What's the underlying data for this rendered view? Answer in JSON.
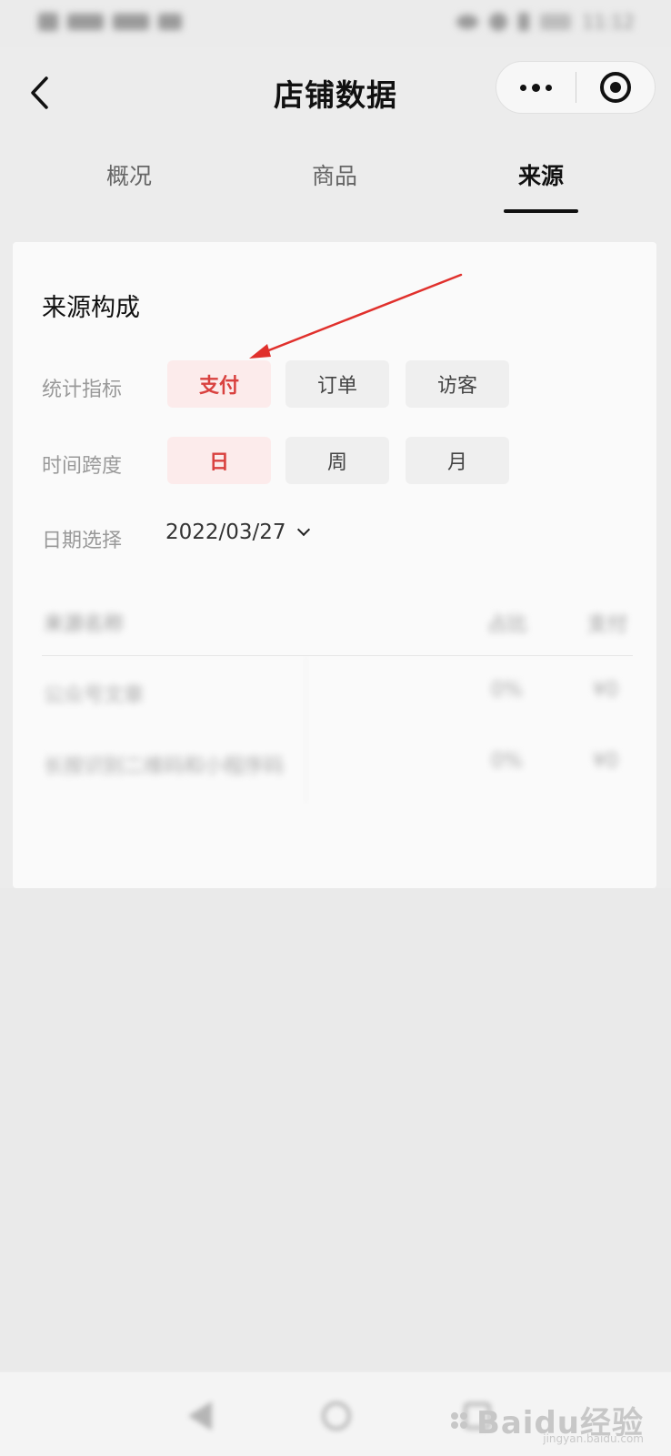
{
  "status_bar": {
    "time": "11:12",
    "battery": "26"
  },
  "header": {
    "title": "店铺数据"
  },
  "tabs": [
    {
      "label": "概况",
      "active": false
    },
    {
      "label": "商品",
      "active": false
    },
    {
      "label": "来源",
      "active": true
    }
  ],
  "card": {
    "title": "来源构成",
    "metric": {
      "label": "统计指标",
      "options": [
        "支付",
        "订单",
        "访客"
      ],
      "selected": "支付"
    },
    "span": {
      "label": "时间跨度",
      "options": [
        "日",
        "周",
        "月"
      ],
      "selected": "日"
    },
    "date": {
      "label": "日期选择",
      "value": "2022/03/27"
    },
    "table": {
      "headers": [
        "来源名称",
        "占比",
        "支付"
      ],
      "rows": [
        [
          "公众号文章",
          "0%",
          "¥0"
        ],
        [
          "长按识别二维码和小程序码",
          "0%",
          "¥0"
        ]
      ]
    }
  },
  "colors": {
    "accent": "#d9413f",
    "chip_active_bg": "#fcebeb",
    "arrow": "#e0302c"
  },
  "watermark": {
    "text": "Baidu经验",
    "sub": "jingyan.baidu.com"
  }
}
